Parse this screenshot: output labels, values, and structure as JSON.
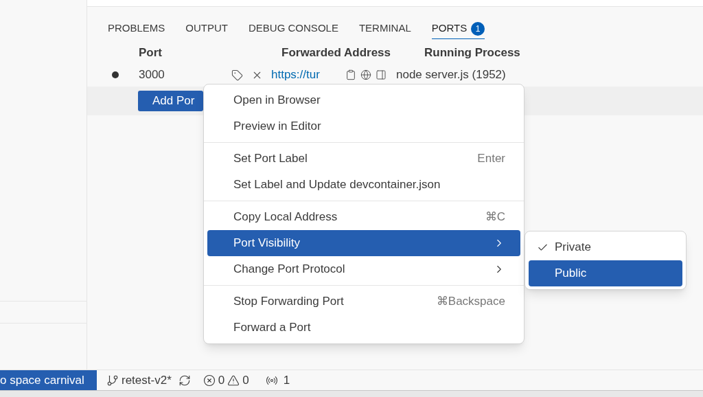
{
  "panel": {
    "tabs": [
      {
        "label": "PROBLEMS",
        "selected": false
      },
      {
        "label": "OUTPUT",
        "selected": false
      },
      {
        "label": "DEBUG CONSOLE",
        "selected": false
      },
      {
        "label": "TERMINAL",
        "selected": false
      },
      {
        "label": "PORTS",
        "selected": true,
        "badge": "1"
      }
    ]
  },
  "ports_table": {
    "columns": [
      "Port",
      "Forwarded Address",
      "Running Process"
    ],
    "rows": [
      {
        "port": "3000",
        "address": "https://tur",
        "process": "node server.js (1952)"
      }
    ],
    "add_button": "Add Por"
  },
  "context_menu": {
    "groups": [
      [
        {
          "label": "Open in Browser",
          "submenu": false,
          "selected": false
        },
        {
          "label": "Preview in Editor",
          "submenu": false,
          "selected": false
        }
      ],
      [
        {
          "label": "Set Port Label",
          "shortcut": "Enter",
          "submenu": false,
          "selected": false
        },
        {
          "label": "Set Label and Update devcontainer.json",
          "submenu": false,
          "selected": false
        }
      ],
      [
        {
          "label": "Copy Local Address",
          "shortcut": "⌘C",
          "submenu": false,
          "selected": false
        },
        {
          "label": "Port Visibility",
          "submenu": true,
          "selected": true
        },
        {
          "label": "Change Port Protocol",
          "submenu": true,
          "selected": false
        }
      ],
      [
        {
          "label": "Stop Forwarding Port",
          "shortcut": "⌘Backspace",
          "submenu": false,
          "selected": false
        },
        {
          "label": "Forward a Port",
          "submenu": false,
          "selected": false
        }
      ]
    ]
  },
  "submenu": {
    "items": [
      {
        "label": "Private",
        "checked": true,
        "selected": false
      },
      {
        "label": "Public",
        "checked": false,
        "selected": true
      }
    ]
  },
  "status_bar": {
    "remote": "o space carnival",
    "branch": "retest-v2*",
    "errors": "0",
    "warnings": "0",
    "ports": "1"
  }
}
